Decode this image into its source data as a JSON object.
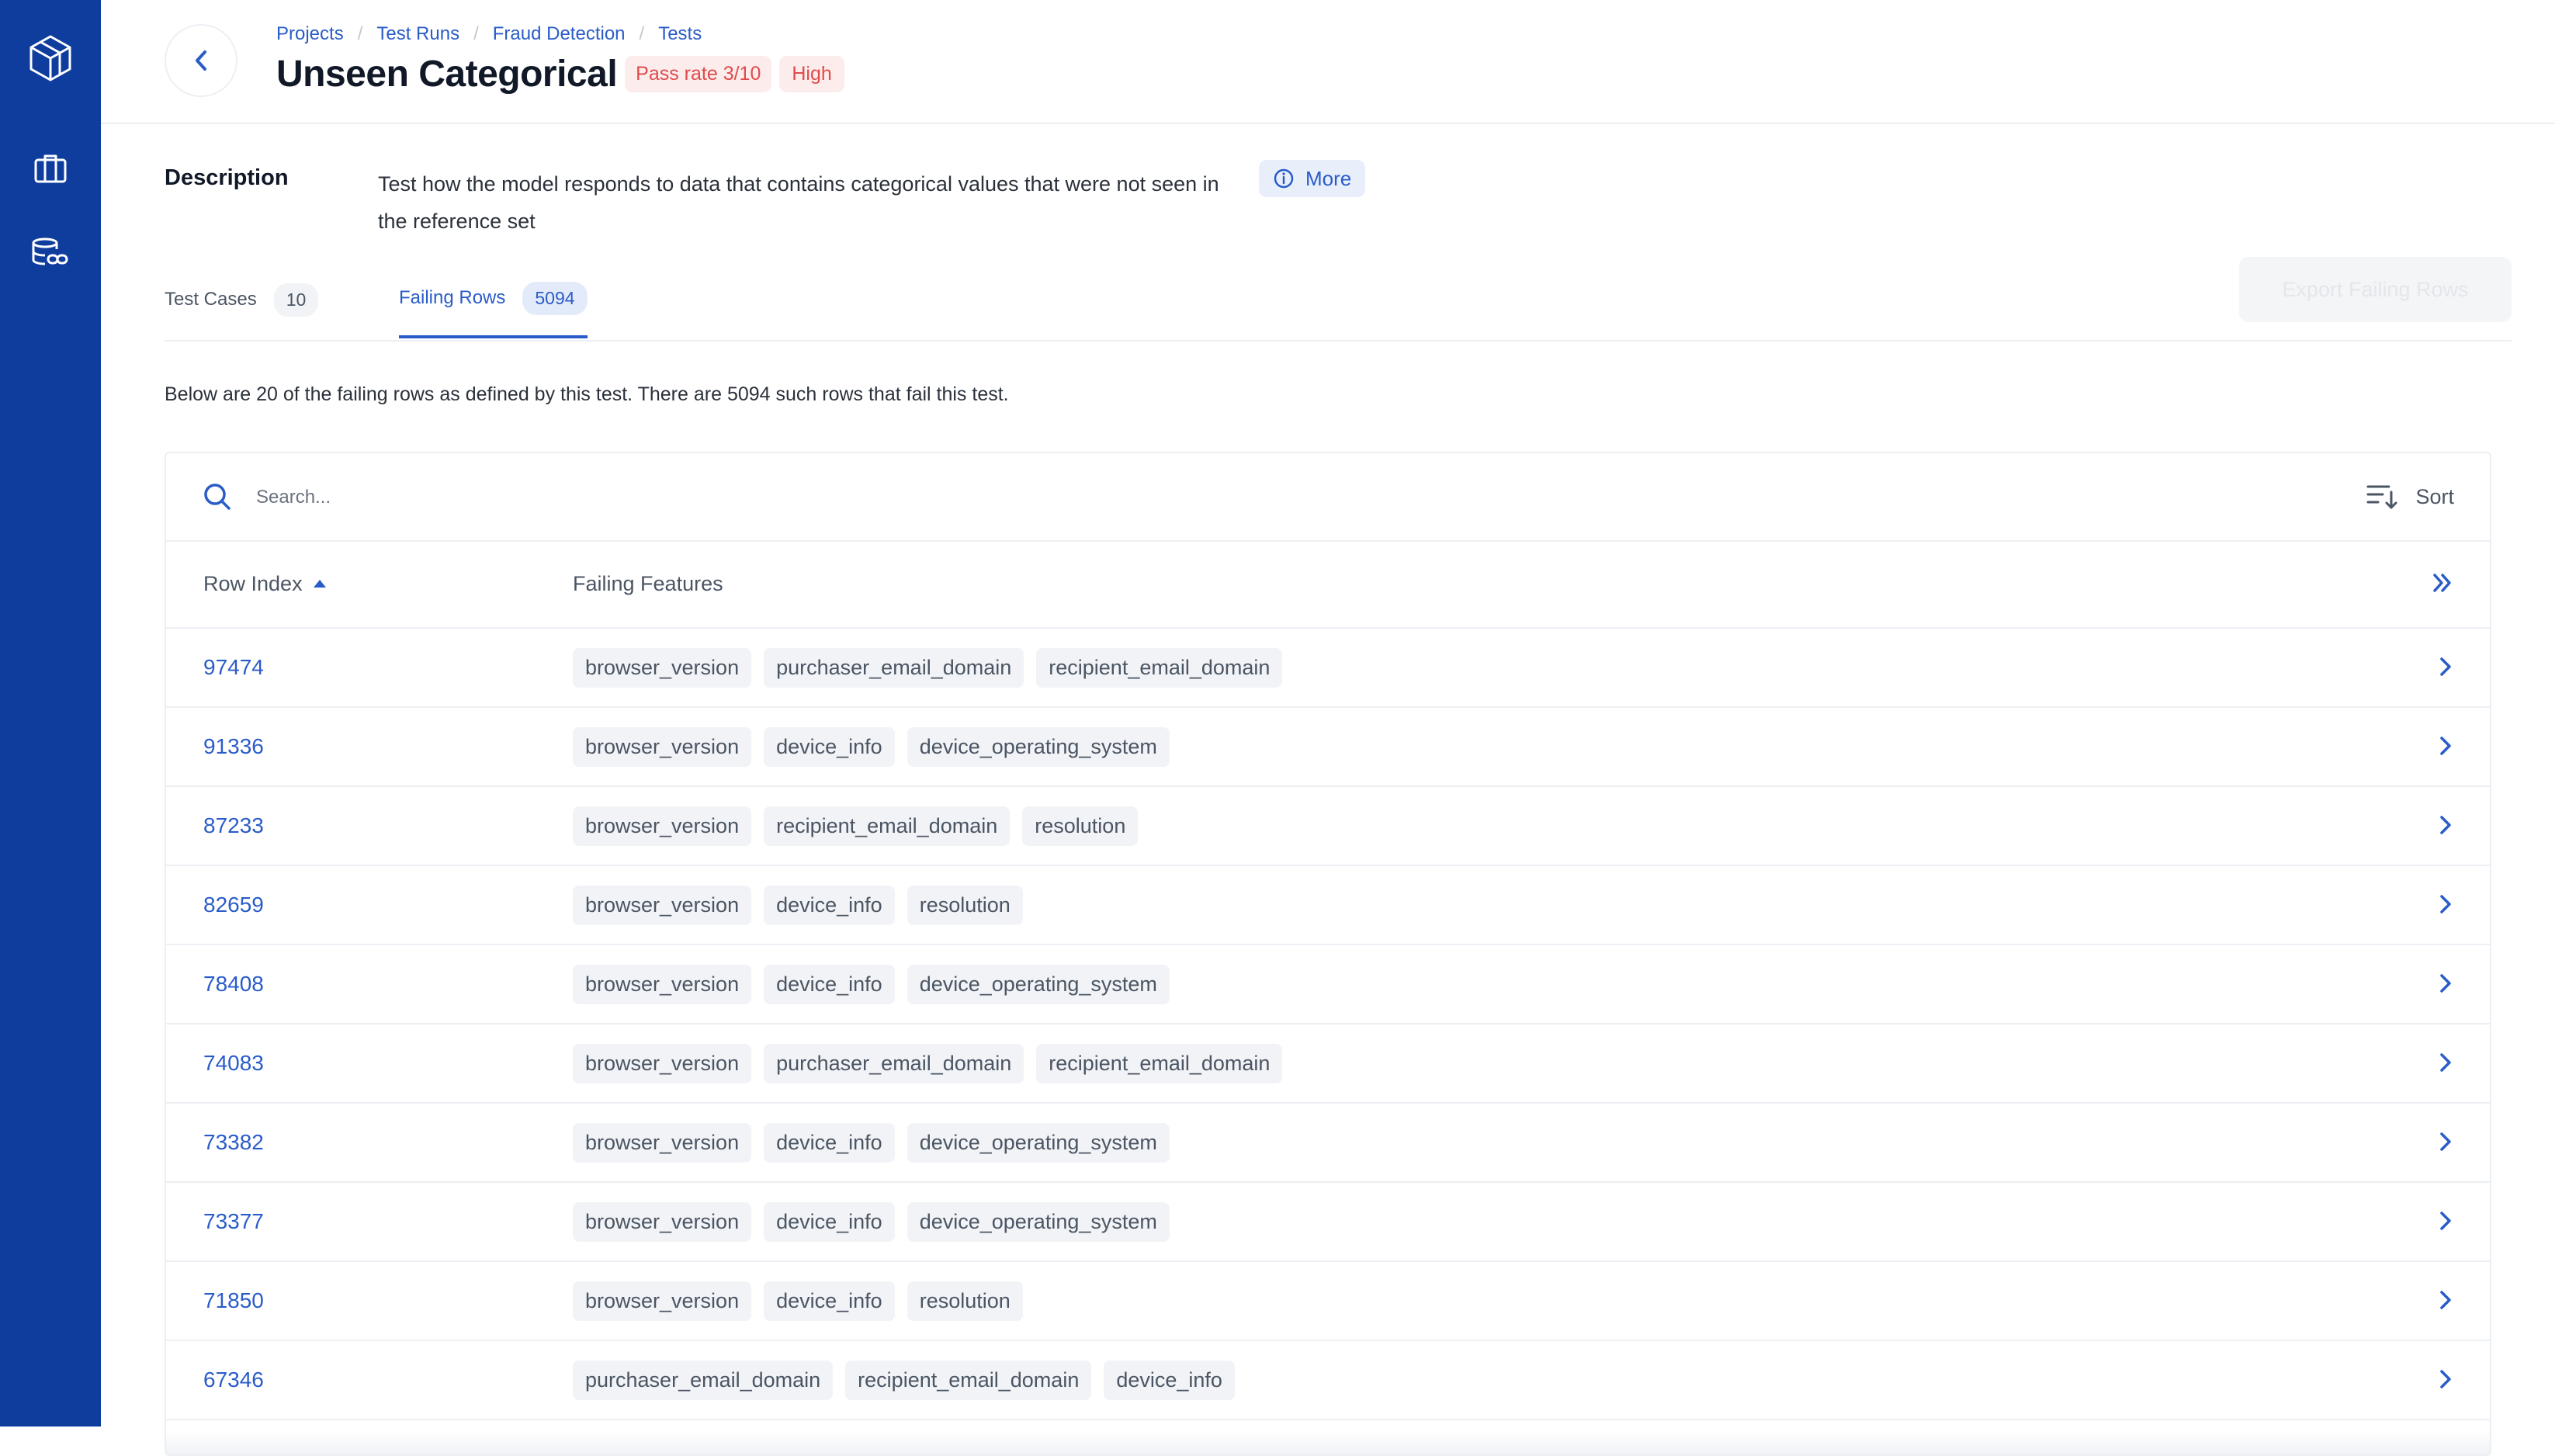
{
  "sidebar": {
    "items": [
      {
        "icon": "cube-logo-icon"
      },
      {
        "icon": "briefcase-icon"
      },
      {
        "icon": "database-link-icon"
      }
    ]
  },
  "header": {
    "breadcrumb": [
      "Projects",
      "Test Runs",
      "Fraud Detection",
      "Tests"
    ],
    "title": "Unseen Categorical",
    "pass_rate": "Pass rate 3/10",
    "severity": "High"
  },
  "description": {
    "label": "Description",
    "text": "Test how the model responds to data that contains categorical values that were not seen in the reference set",
    "more_label": "More"
  },
  "tabs": [
    {
      "label": "Test Cases",
      "count": "10",
      "active": false
    },
    {
      "label": "Failing Rows",
      "count": "5094",
      "active": true
    }
  ],
  "export_label": "Export Failing Rows",
  "summary": "Below are 20 of the failing rows as defined by this test. There are 5094 such rows that fail this test.",
  "table": {
    "search_placeholder": "Search...",
    "sort_label": "Sort",
    "columns": [
      "Row Index",
      "Failing Features"
    ],
    "rows": [
      {
        "index": "97474",
        "features": [
          "browser_version",
          "purchaser_email_domain",
          "recipient_email_domain"
        ]
      },
      {
        "index": "91336",
        "features": [
          "browser_version",
          "device_info",
          "device_operating_system"
        ]
      },
      {
        "index": "87233",
        "features": [
          "browser_version",
          "recipient_email_domain",
          "resolution"
        ]
      },
      {
        "index": "82659",
        "features": [
          "browser_version",
          "device_info",
          "resolution"
        ]
      },
      {
        "index": "78408",
        "features": [
          "browser_version",
          "device_info",
          "device_operating_system"
        ]
      },
      {
        "index": "74083",
        "features": [
          "browser_version",
          "purchaser_email_domain",
          "recipient_email_domain"
        ]
      },
      {
        "index": "73382",
        "features": [
          "browser_version",
          "device_info",
          "device_operating_system"
        ]
      },
      {
        "index": "73377",
        "features": [
          "browser_version",
          "device_info",
          "device_operating_system"
        ]
      },
      {
        "index": "71850",
        "features": [
          "browser_version",
          "device_info",
          "resolution"
        ]
      },
      {
        "index": "67346",
        "features": [
          "purchaser_email_domain",
          "recipient_email_domain",
          "device_info"
        ]
      }
    ]
  },
  "colors": {
    "sidebar": "#0f3d9e",
    "accent": "#2a5cc9",
    "danger": "#e04b4b"
  }
}
